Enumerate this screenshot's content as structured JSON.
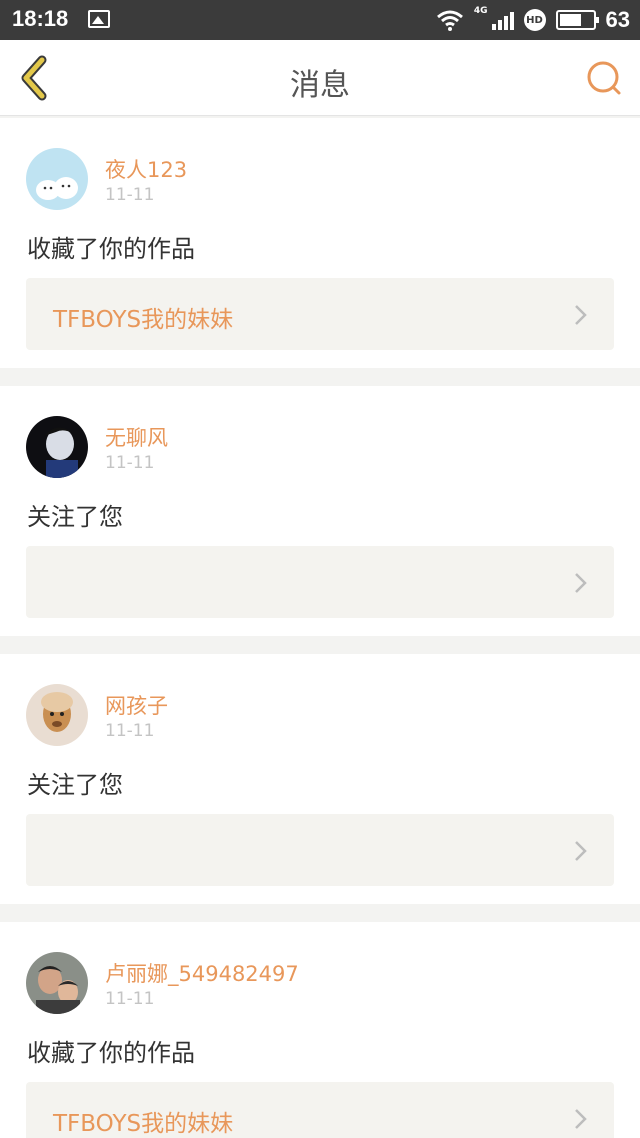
{
  "status_bar": {
    "time": "18:18",
    "network": "4G",
    "hd": "HD",
    "battery": "63",
    "icons": [
      "image-icon",
      "wifi-icon",
      "signal-icon",
      "hd-icon",
      "battery-icon"
    ]
  },
  "header": {
    "title": "消息",
    "back_icon": "back-icon",
    "search_icon": "search-icon",
    "accent": "#e8975a",
    "back_color": "#e3c84a"
  },
  "messages": [
    {
      "name": "夜人123",
      "date": "11-11",
      "action": "收藏了你的作品",
      "work": "TFBOYS我的妹妹"
    },
    {
      "name": "无聊风",
      "date": "11-11",
      "action": "关注了您",
      "work": ""
    },
    {
      "name": "网孩子",
      "date": "11-11",
      "action": "关注了您",
      "work": ""
    },
    {
      "name": "卢丽娜_549482497",
      "date": "11-11",
      "action": "收藏了你的作品",
      "work": "TFBOYS我的妹妹"
    }
  ]
}
